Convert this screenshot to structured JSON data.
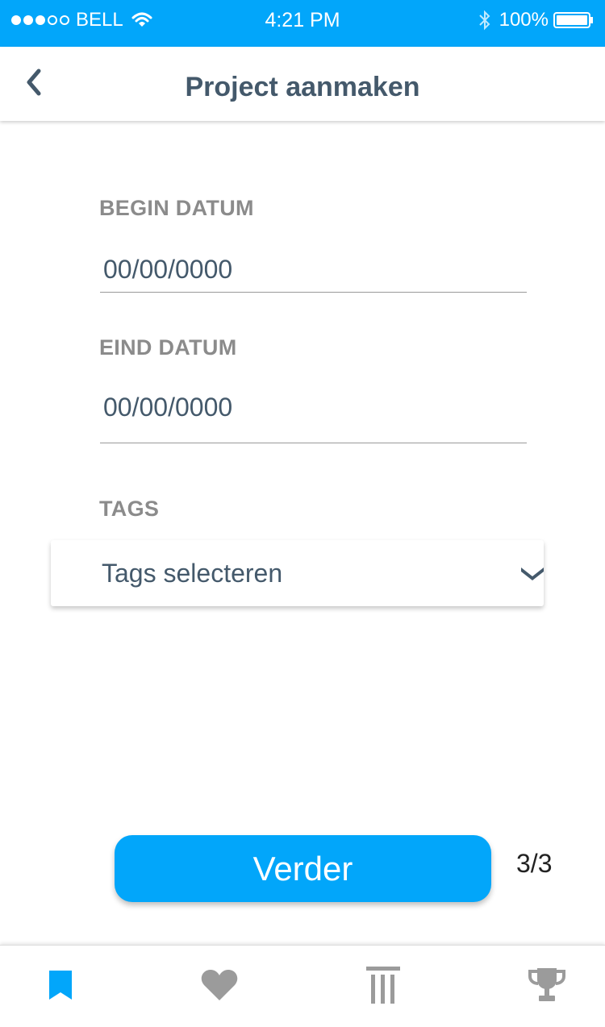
{
  "status_bar": {
    "carrier": "BELL",
    "time": "4:21 PM",
    "battery": "100%",
    "signal_icon": "signal-dots-icon",
    "wifi_icon": "wifi-icon",
    "bluetooth_icon": "bluetooth-icon",
    "battery_icon": "battery-icon"
  },
  "header": {
    "title": "Project aanmaken",
    "back_icon": "chevron-left-icon"
  },
  "form": {
    "begin_label": "BEGIN DATUM",
    "begin_placeholder": "00/00/0000",
    "end_label": "EIND DATUM",
    "end_placeholder": "00/00/0000",
    "tags_label": "TAGS",
    "tags_select": "Tags selecteren"
  },
  "actions": {
    "next_label": "Verder",
    "step": "3/3"
  },
  "tab_bar": {
    "items": [
      {
        "icon": "bookmark-icon",
        "active": true
      },
      {
        "icon": "heart-icon",
        "active": false
      },
      {
        "icon": "pillar-icon",
        "active": false
      },
      {
        "icon": "trophy-icon",
        "active": false
      }
    ]
  },
  "colors": {
    "accent": "#02a6fa",
    "heading": "#44596b",
    "label": "#8b8b8b",
    "inactive_icon": "#9b9b9b"
  }
}
